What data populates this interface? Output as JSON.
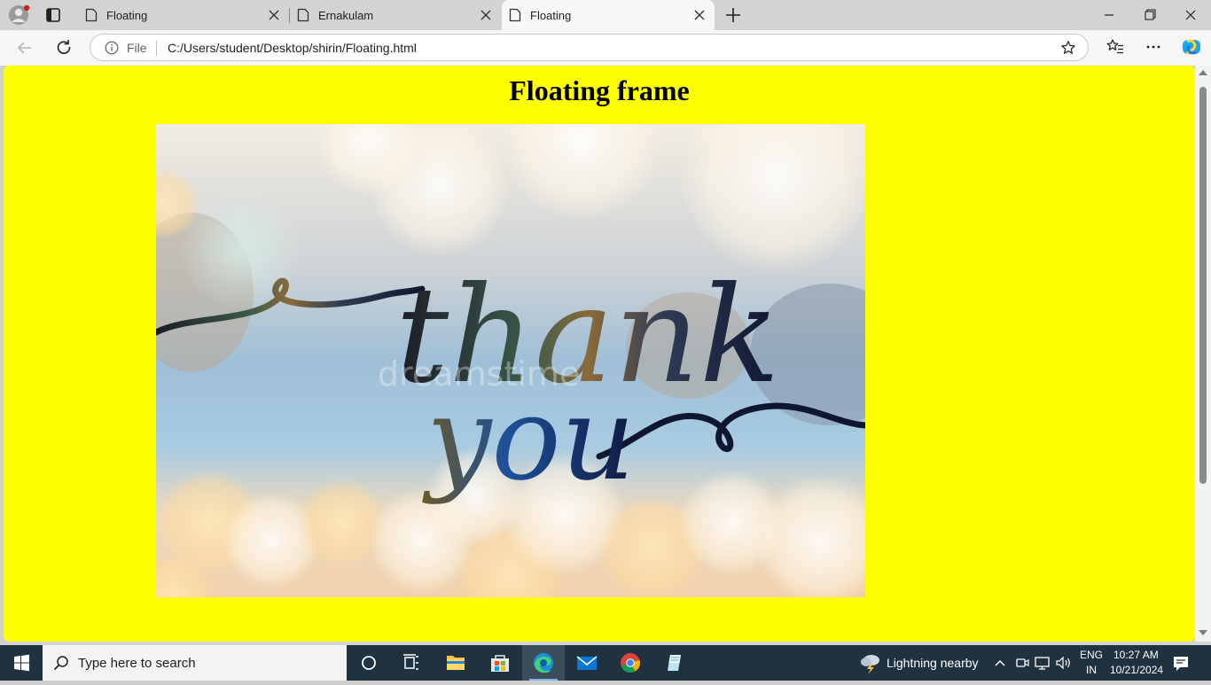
{
  "browser": {
    "tabs": [
      {
        "label": "Floating",
        "active": false
      },
      {
        "label": "Ernakulam",
        "active": false
      },
      {
        "label": "Floating",
        "active": true
      }
    ],
    "address": {
      "scheme_label": "File",
      "url": "C:/Users/student/Desktop/shirin/Floating.html"
    }
  },
  "page": {
    "heading": "Floating frame",
    "background_color": "#ffff00",
    "frame_image": {
      "script_line1": "thank",
      "script_line2": "you",
      "watermark": "dreamstime"
    }
  },
  "taskbar": {
    "search_placeholder": "Type here to search",
    "weather": "Lightning nearby",
    "language": "ENG",
    "region": "IN",
    "time": "10:27 AM",
    "date": "10/21/2024"
  }
}
